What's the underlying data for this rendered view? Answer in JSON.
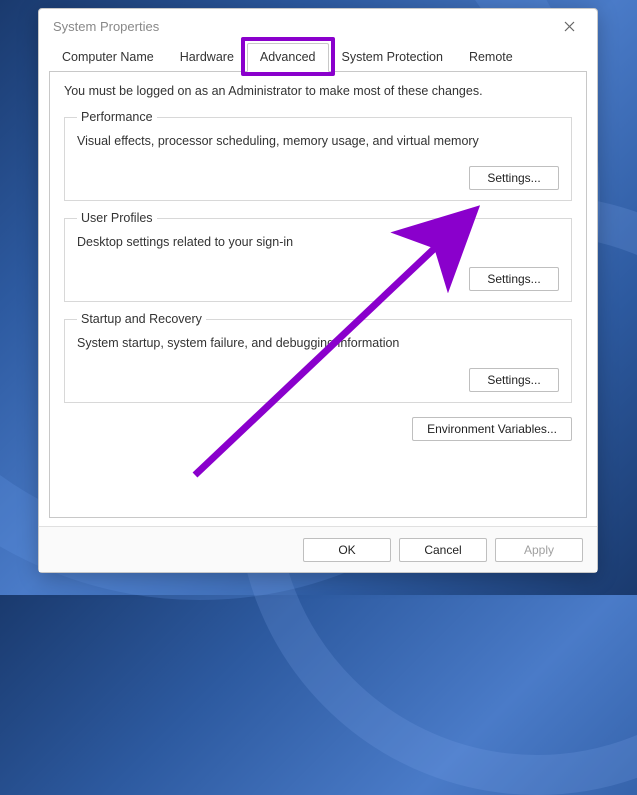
{
  "window": {
    "title": "System Properties"
  },
  "tabs": {
    "computer_name": "Computer Name",
    "hardware": "Hardware",
    "advanced": "Advanced",
    "system_protection": "System Protection",
    "remote": "Remote"
  },
  "intro": "You must be logged on as an Administrator to make most of these changes.",
  "performance": {
    "legend": "Performance",
    "desc": "Visual effects, processor scheduling, memory usage, and virtual memory",
    "button": "Settings..."
  },
  "user_profiles": {
    "legend": "User Profiles",
    "desc": "Desktop settings related to your sign-in",
    "button": "Settings..."
  },
  "startup": {
    "legend": "Startup and Recovery",
    "desc": "System startup, system failure, and debugging information",
    "button": "Settings..."
  },
  "env_button": "Environment Variables...",
  "buttons": {
    "ok": "OK",
    "cancel": "Cancel",
    "apply": "Apply"
  },
  "highlight_color": "#8a00cc"
}
